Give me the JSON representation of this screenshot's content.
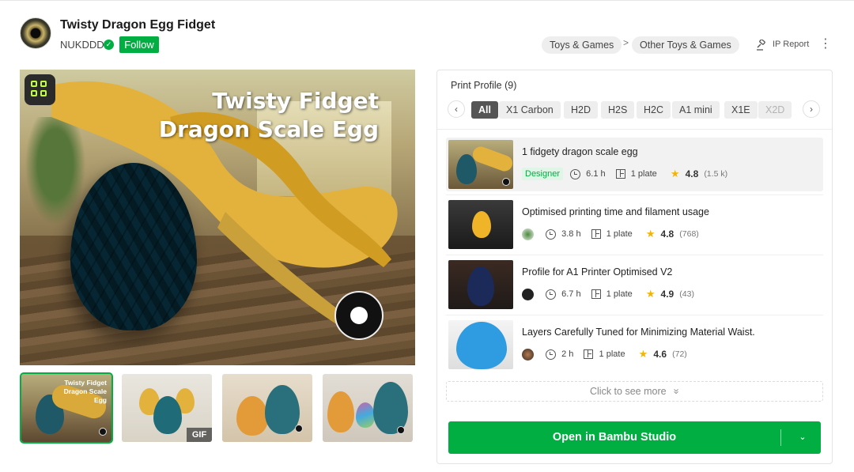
{
  "header": {
    "title": "Twisty Dragon Egg Fidget",
    "author": "NUKDDD",
    "verified_mark": "✓",
    "follow_label": "Follow"
  },
  "breadcrumb": {
    "items": [
      "Toys & Games",
      "Other Toys & Games"
    ],
    "separator": ">"
  },
  "actions": {
    "ip_report_label": "IP Report",
    "more_label": "⋮"
  },
  "gallery": {
    "main_overlay_text": [
      "Twisty Fidget",
      "Dragon Scale Egg"
    ],
    "thumb_overlay_text": [
      "Twisty Fidget",
      "Dragon Scale Egg"
    ],
    "gif_badge": "GIF"
  },
  "print_profile": {
    "title": "Print Profile (9)",
    "prev_label": "‹",
    "next_label": "›",
    "filters": [
      "All",
      "X1 Carbon",
      "H2D",
      "H2S",
      "H2C",
      "A1 mini",
      "X1E",
      "X2D"
    ],
    "active_filter": "All",
    "profiles": [
      {
        "name": "1 fidgety dragon scale egg",
        "badge": "Designer",
        "time": "6.1 h",
        "plates": "1 plate",
        "rating": "4.8",
        "count": "(1.5 k)"
      },
      {
        "name": "Optimised printing time and filament usage",
        "time": "3.8 h",
        "plates": "1 plate",
        "rating": "4.8",
        "count": "(768)"
      },
      {
        "name": "Profile for A1 Printer Optimised V2",
        "time": "6.7 h",
        "plates": "1 plate",
        "rating": "4.9",
        "count": "(43)"
      },
      {
        "name": "Layers Carefully Tuned for Minimizing Material Waist.",
        "time": "2 h",
        "plates": "1 plate",
        "rating": "4.6",
        "count": "(72)"
      }
    ],
    "see_more_label": "Click to see more",
    "see_more_icon": "»",
    "open_button_label": "Open in Bambu Studio",
    "open_caret": "⌄"
  },
  "colors": {
    "accent": "#00ae42",
    "star": "#f5b400",
    "egg_teal": "#1f5866",
    "egg_gold": "#e3b23c"
  }
}
